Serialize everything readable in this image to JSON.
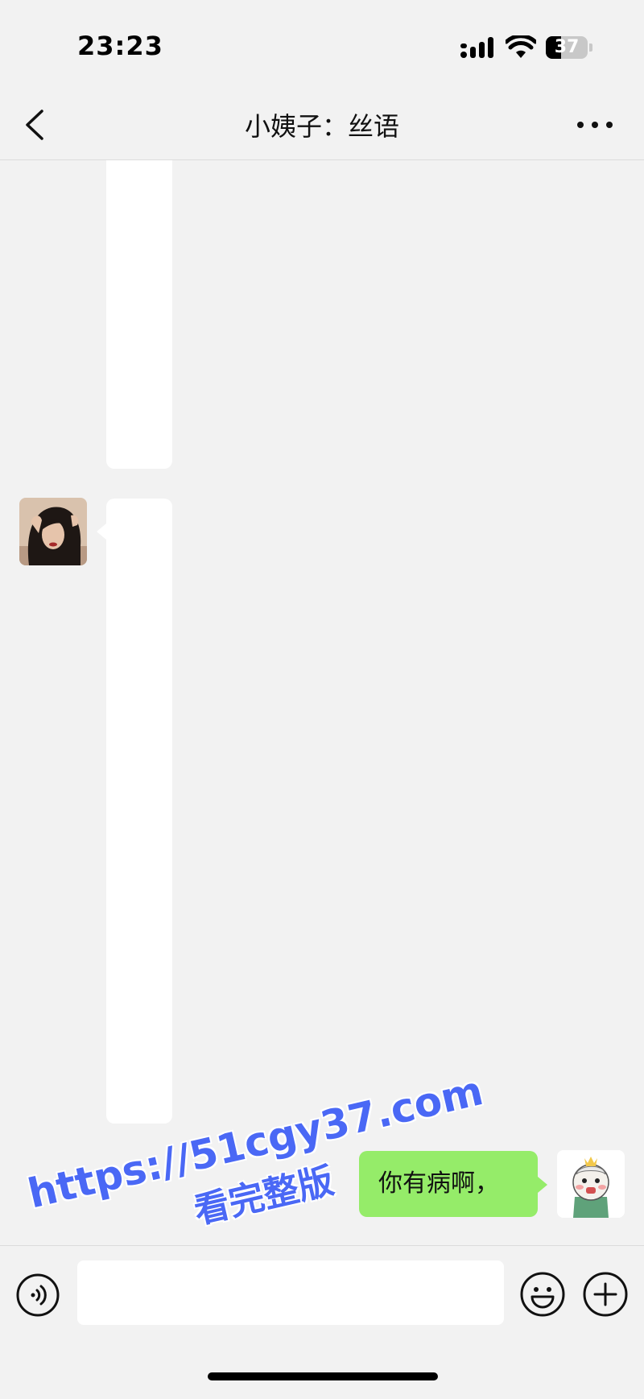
{
  "status_bar": {
    "time": "23:23",
    "battery_level": "37"
  },
  "nav": {
    "title": "小姨子：丝语",
    "back_icon": "chevron-left-icon",
    "more_icon": "more-dots-icon"
  },
  "messages": [
    {
      "side": "left",
      "type": "blank-image",
      "has_avatar": false
    },
    {
      "side": "left",
      "type": "blank-image",
      "has_avatar": true
    },
    {
      "side": "right",
      "type": "text",
      "text": "你有病啊，"
    }
  ],
  "watermark": {
    "line1": "https://51cgy37.com",
    "line2": "看完整版"
  },
  "input_bar": {
    "voice_icon": "voice-icon",
    "emoji_icon": "emoji-icon",
    "plus_icon": "plus-icon",
    "placeholder": ""
  },
  "colors": {
    "background": "#f2f2f2",
    "my_bubble": "#95ec69",
    "their_bubble": "#ffffff",
    "watermark": "#4a68f5"
  }
}
